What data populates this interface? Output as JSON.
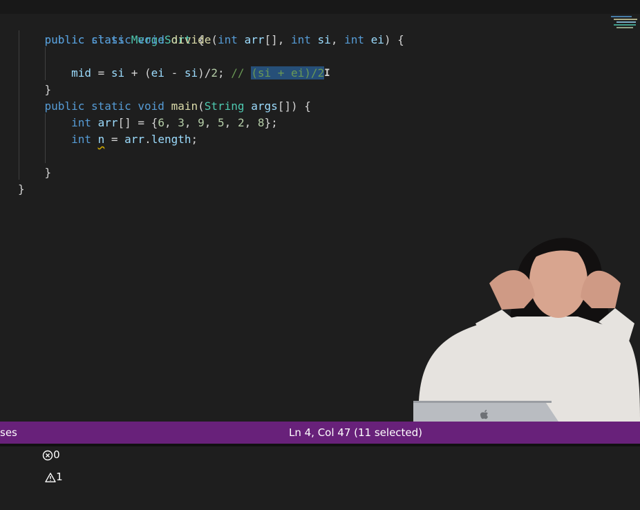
{
  "editor": {
    "lines": {
      "l1": {
        "kw1": "public",
        "kw2": "class",
        "cls": "MergeSort",
        "brace": "{"
      },
      "l2": {
        "kw1": "public",
        "kw2": "static",
        "kw3": "void",
        "fn": "divide",
        "p_open": "(",
        "t1": "int",
        "v1": "arr",
        "s1": "[], ",
        "t2": "int",
        "v2": "si",
        "s2": ", ",
        "t3": "int",
        "v3": "ei",
        "s3": ") {"
      },
      "l4": {
        "v1": "mid",
        "s1": " = ",
        "v2": "si",
        "s2": " + (",
        "v3": "ei",
        "s3": " - ",
        "v4": "si",
        "s4": ")/",
        "n1": "2",
        "s5": "; ",
        "comment": "// ",
        "selected": "(si + ei)/2"
      },
      "l5": {
        "brace": "}"
      },
      "l6": {
        "kw1": "public",
        "kw2": "static",
        "kw3": "void",
        "fn": "main",
        "p_open": "(",
        "t1": "String",
        "v1": "args",
        "s1": "[]) {"
      },
      "l7": {
        "t1": "int",
        "v1": "arr",
        "s1": "[] = {",
        "n1": "6",
        "n2": "3",
        "n3": "9",
        "n4": "5",
        "n5": "2",
        "n6": "8",
        "comma": ", ",
        "s2": "};"
      },
      "l8": {
        "t1": "int",
        "v1": "n",
        "s1": " = ",
        "v2": "arr",
        "s2": ".",
        "v3": "length",
        "s3": ";"
      },
      "l10": {
        "brace": "}"
      },
      "l11": {
        "brace": "}"
      }
    }
  },
  "statusbar": {
    "left_fragment": "ses",
    "errors": "0",
    "warnings": "1",
    "cursor_position": "Ln 4, Col 47 (11 selected)"
  },
  "colors": {
    "editor_bg": "#1e1e1e",
    "statusbar_bg": "#68217a",
    "keyword": "#569cd6",
    "type": "#4ec9b0",
    "function": "#dcdcaa",
    "variable": "#9cdcfe",
    "number": "#b5cea8",
    "comment": "#6a9955",
    "selection": "#264f78"
  },
  "icons": {
    "errors": "error-circle-icon",
    "warnings": "warning-triangle-icon",
    "laptop": "apple-logo-icon"
  }
}
